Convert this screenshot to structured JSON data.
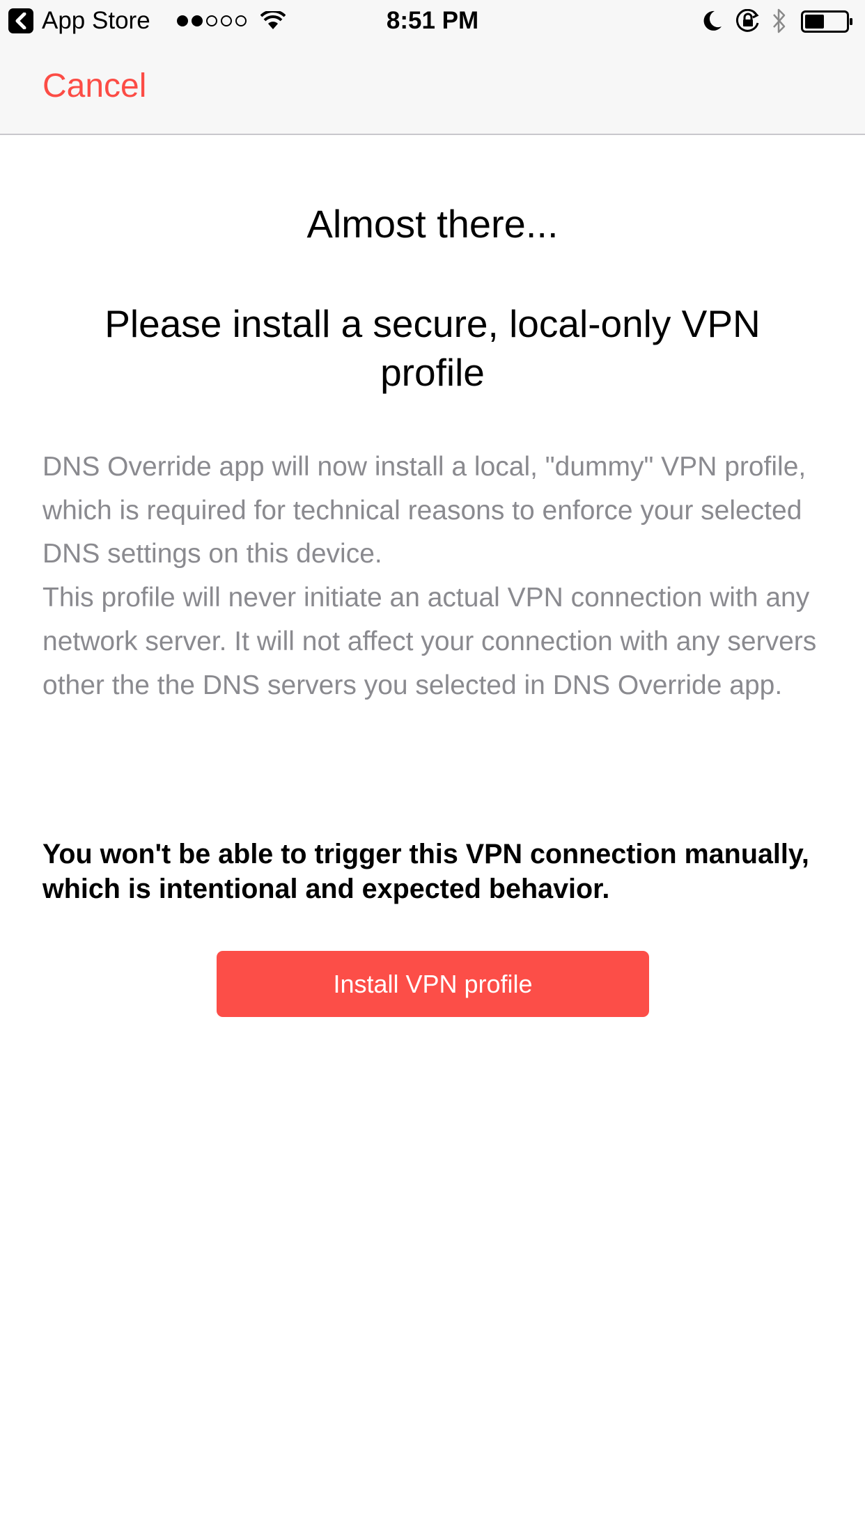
{
  "status_bar": {
    "back_app": "App Store",
    "time": "8:51 PM",
    "signal_bars_filled": 2,
    "signal_bars_total": 5,
    "icons": [
      "back-arrow-icon",
      "signal-icon",
      "wifi-icon",
      "moon-icon",
      "rotation-lock-icon",
      "bluetooth-icon",
      "battery-icon"
    ]
  },
  "nav": {
    "cancel_label": "Cancel"
  },
  "content": {
    "title": "Almost there...",
    "subtitle": "Please install a secure, local-only VPN profile",
    "description": "DNS Override app will now install a local, \"dummy\" VPN profile, which is required for technical reasons to enforce your selected DNS settings on this device.\nThis profile will never initiate an actual VPN connection with any network server. It will not affect your connection with any servers other the the DNS servers you selected in DNS Override app.",
    "warning": "You won't be able to trigger this VPN connection manually, which is intentional and expected behavior.",
    "install_button_label": "Install VPN profile"
  },
  "colors": {
    "accent": "#fc4c45",
    "button": "#fc4e48",
    "description_text": "#8a8a8f",
    "bar_background": "#f7f7f7"
  }
}
